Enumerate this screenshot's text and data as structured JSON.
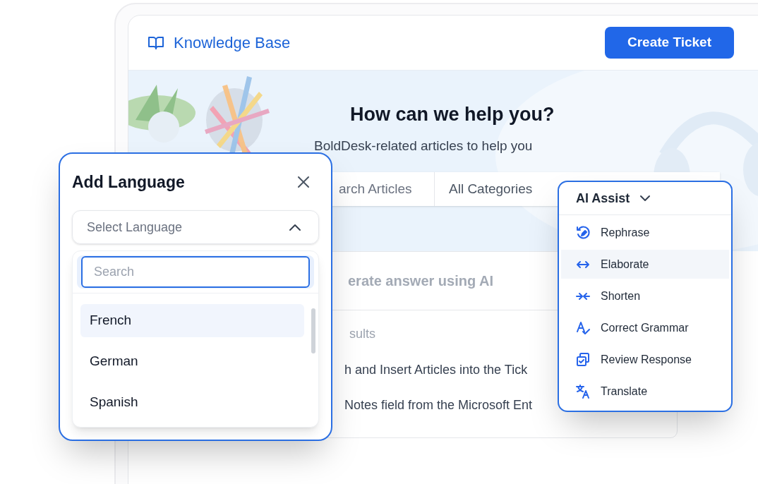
{
  "header": {
    "title": "Knowledge Base",
    "button": "Create Ticket"
  },
  "hero": {
    "kind": "picture",
    "heading": "How can we help you?",
    "subheading": "BoldDesk-related articles to help you"
  },
  "search_bar": {
    "search_text": "arch Articles",
    "category": "All Categories"
  },
  "answer_card": {
    "prompt": "erate answer using AI",
    "results_label": "sults",
    "results": [
      "h and Insert Articles into the Tick",
      "Notes field from the Microsoft Ent"
    ]
  },
  "add_language_dialog": {
    "title": "Add Language",
    "select": {
      "placeholder": "Select Language",
      "expanded": true
    },
    "search": {
      "placeholder": "Search"
    },
    "options": [
      {
        "label": "French",
        "selected": true
      },
      {
        "label": "German",
        "selected": false
      },
      {
        "label": "Spanish",
        "selected": false
      }
    ]
  },
  "ai_assist_menu": {
    "title": "AI Assist",
    "items": [
      {
        "label": "Rephrase",
        "kind": "rephrase",
        "selected": false
      },
      {
        "label": "Elaborate",
        "kind": "elaborate",
        "selected": true
      },
      {
        "label": "Shorten",
        "kind": "shorten",
        "selected": false
      },
      {
        "label": "Correct Grammar",
        "kind": "grammar",
        "selected": false
      },
      {
        "label": "Review Response",
        "kind": "review",
        "selected": false
      },
      {
        "label": "Translate",
        "kind": "translate",
        "selected": false
      }
    ]
  }
}
